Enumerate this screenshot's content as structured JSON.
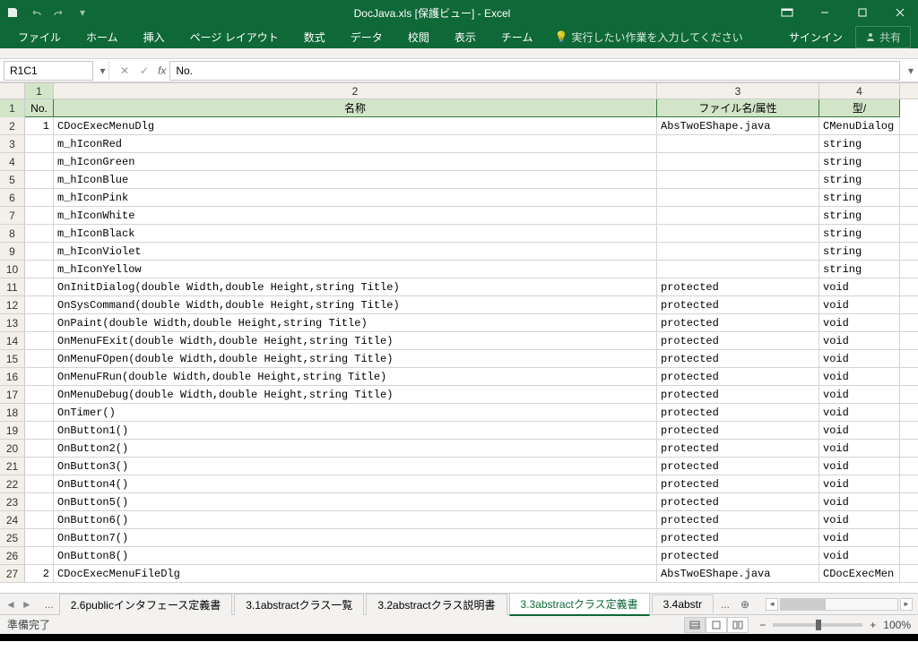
{
  "title": "DocJava.xls  [保護ビュー] - Excel",
  "qat": {
    "save": "保存",
    "undo": "元に戻す",
    "redo": "やり直し"
  },
  "ribbon": {
    "tabs": [
      "ファイル",
      "ホーム",
      "挿入",
      "ページ レイアウト",
      "数式",
      "データ",
      "校閲",
      "表示",
      "チーム"
    ],
    "tell_placeholder": "実行したい作業を入力してください",
    "signin": "サインイン",
    "share": "共有"
  },
  "name_box": "R1C1",
  "formula": "No.",
  "col_headers": [
    "1",
    "2",
    "3",
    "4"
  ],
  "table_headers": {
    "no": "No.",
    "name": "名称",
    "file": "ファイル名/属性",
    "type": "型/"
  },
  "rows": [
    {
      "r": "2",
      "no": "1",
      "name": "CDocExecMenuDlg",
      "file": "AbsTwoEShape.java",
      "type": "CMenuDialog"
    },
    {
      "r": "3",
      "no": "",
      "name": "m_hIconRed",
      "file": "",
      "type": "string"
    },
    {
      "r": "4",
      "no": "",
      "name": "m_hIconGreen",
      "file": "",
      "type": "string"
    },
    {
      "r": "5",
      "no": "",
      "name": "m_hIconBlue",
      "file": "",
      "type": "string"
    },
    {
      "r": "6",
      "no": "",
      "name": "m_hIconPink",
      "file": "",
      "type": "string"
    },
    {
      "r": "7",
      "no": "",
      "name": "m_hIconWhite",
      "file": "",
      "type": "string"
    },
    {
      "r": "8",
      "no": "",
      "name": "m_hIconBlack",
      "file": "",
      "type": "string"
    },
    {
      "r": "9",
      "no": "",
      "name": "m_hIconViolet",
      "file": "",
      "type": "string"
    },
    {
      "r": "10",
      "no": "",
      "name": "m_hIconYellow",
      "file": "",
      "type": "string"
    },
    {
      "r": "11",
      "no": "",
      "name": "OnInitDialog(double Width,double Height,string Title)",
      "file": "protected",
      "type": "void"
    },
    {
      "r": "12",
      "no": "",
      "name": "OnSysCommand(double Width,double Height,string Title)",
      "file": "protected",
      "type": "void"
    },
    {
      "r": "13",
      "no": "",
      "name": "OnPaint(double Width,double Height,string Title)",
      "file": "protected",
      "type": "void"
    },
    {
      "r": "14",
      "no": "",
      "name": "OnMenuFExit(double Width,double Height,string Title)",
      "file": "protected",
      "type": "void"
    },
    {
      "r": "15",
      "no": "",
      "name": "OnMenuFOpen(double Width,double Height,string Title)",
      "file": "protected",
      "type": "void"
    },
    {
      "r": "16",
      "no": "",
      "name": "OnMenuFRun(double Width,double Height,string Title)",
      "file": "protected",
      "type": "void"
    },
    {
      "r": "17",
      "no": "",
      "name": "OnMenuDebug(double Width,double Height,string Title)",
      "file": "protected",
      "type": "void"
    },
    {
      "r": "18",
      "no": "",
      "name": "OnTimer()",
      "file": "protected",
      "type": "void"
    },
    {
      "r": "19",
      "no": "",
      "name": "OnButton1()",
      "file": "protected",
      "type": "void"
    },
    {
      "r": "20",
      "no": "",
      "name": "OnButton2()",
      "file": "protected",
      "type": "void"
    },
    {
      "r": "21",
      "no": "",
      "name": "OnButton3()",
      "file": "protected",
      "type": "void"
    },
    {
      "r": "22",
      "no": "",
      "name": "OnButton4()",
      "file": "protected",
      "type": "void"
    },
    {
      "r": "23",
      "no": "",
      "name": "OnButton5()",
      "file": "protected",
      "type": "void"
    },
    {
      "r": "24",
      "no": "",
      "name": "OnButton6()",
      "file": "protected",
      "type": "void"
    },
    {
      "r": "25",
      "no": "",
      "name": "OnButton7()",
      "file": "protected",
      "type": "void"
    },
    {
      "r": "26",
      "no": "",
      "name": "OnButton8()",
      "file": "protected",
      "type": "void"
    },
    {
      "r": "27",
      "no": "2",
      "name": "CDocExecMenuFileDlg",
      "file": "AbsTwoEShape.java",
      "type": "CDocExecMen"
    }
  ],
  "sheet_tabs": {
    "overflow": "...",
    "tabs": [
      "2.6publicインタフェース定義書",
      "3.1abstractクラス一覧",
      "3.2abstractクラス説明書",
      "3.3abstractクラス定義書",
      "3.4abstr"
    ],
    "active_index": 3,
    "more": "...",
    "add": "+"
  },
  "status": {
    "ready": "準備完了",
    "zoom": "100%"
  }
}
